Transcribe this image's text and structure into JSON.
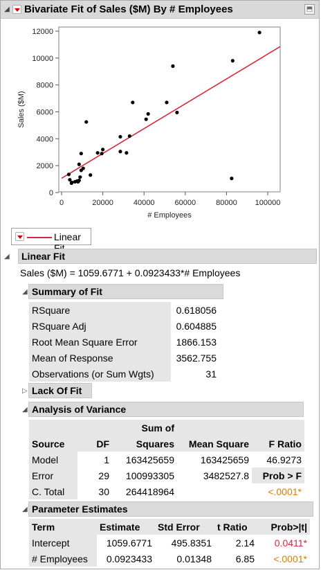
{
  "report": {
    "title": "Bivariate Fit of Sales ($M) By # Employees"
  },
  "chart_data": {
    "type": "scatter",
    "xlabel": "# Employees",
    "ylabel": "Sales ($M)",
    "xlim": [
      0,
      100000
    ],
    "ylim": [
      0,
      12000
    ],
    "x_ticks": [
      "0",
      "20000",
      "40000",
      "60000",
      "80000",
      "100000"
    ],
    "y_ticks": [
      "0",
      "2000",
      "4000",
      "6000",
      "8000",
      "10000",
      "12000"
    ],
    "points": [
      [
        96000,
        11900
      ],
      [
        83000,
        9800
      ],
      [
        54000,
        9400
      ],
      [
        51000,
        6700
      ],
      [
        56000,
        5950
      ],
      [
        42000,
        5850
      ],
      [
        41000,
        5450
      ],
      [
        34500,
        6700
      ],
      [
        33000,
        4200
      ],
      [
        28500,
        4150
      ],
      [
        12000,
        5250
      ],
      [
        9500,
        2900
      ],
      [
        17500,
        2950
      ],
      [
        20000,
        3200
      ],
      [
        19500,
        2900
      ],
      [
        28500,
        3050
      ],
      [
        31500,
        2950
      ],
      [
        8500,
        2100
      ],
      [
        10500,
        1800
      ],
      [
        9500,
        1650
      ],
      [
        14000,
        1300
      ],
      [
        9000,
        1150
      ],
      [
        8500,
        900
      ],
      [
        8000,
        800
      ],
      [
        3500,
        1350
      ],
      [
        4000,
        950
      ],
      [
        5000,
        750
      ],
      [
        4800,
        700
      ],
      [
        7500,
        850
      ],
      [
        6500,
        800
      ],
      [
        82500,
        1050
      ]
    ],
    "fit_line": {
      "intercept": 1059.6771,
      "slope": 0.0923433,
      "color": "#d6283b"
    },
    "point_color": "#000000",
    "grid": false
  },
  "legend": {
    "label": "Linear Fit",
    "color": "#d6283b"
  },
  "linear_fit": {
    "header": "Linear Fit",
    "equation": "Sales ($M) = 1059.6771 + 0.0923433*# Employees"
  },
  "summary_of_fit": {
    "header": "Summary of Fit",
    "rows": [
      {
        "label": "RSquare",
        "value": "0.618056"
      },
      {
        "label": "RSquare Adj",
        "value": "0.604885"
      },
      {
        "label": "Root Mean Square Error",
        "value": "1866.153"
      },
      {
        "label": "Mean of Response",
        "value": "3562.755"
      },
      {
        "label": "Observations (or Sum Wgts)",
        "value": "31"
      }
    ]
  },
  "lack_of_fit": {
    "header": "Lack Of Fit"
  },
  "anova": {
    "header": "Analysis of Variance",
    "columns": {
      "source": "Source",
      "df": "DF",
      "ss_top": "Sum of",
      "ss_bottom": "Squares",
      "ms": "Mean Square",
      "f": "F Ratio",
      "prob_label": "Prob > F"
    },
    "rows": [
      {
        "source": "Model",
        "df": "1",
        "ss": "163425659",
        "ms": "163425659",
        "f": "46.9273"
      },
      {
        "source": "Error",
        "df": "29",
        "ss": "100993305",
        "ms": "3482527.8",
        "f": ""
      },
      {
        "source": "C. Total",
        "df": "30",
        "ss": "264418964",
        "ms": "",
        "f": ""
      }
    ],
    "prob_value": "<.0001*"
  },
  "parameter_estimates": {
    "header": "Parameter Estimates",
    "columns": {
      "term": "Term",
      "estimate": "Estimate",
      "std_error": "Std Error",
      "t_ratio": "t Ratio",
      "prob": "Prob>|t|"
    },
    "rows": [
      {
        "term": "Intercept",
        "estimate": "1059.6771",
        "std_error": "495.8351",
        "t_ratio": "2.14",
        "prob": "0.0411*"
      },
      {
        "term": "# Employees",
        "estimate": "0.0923433",
        "std_error": "0.01348",
        "t_ratio": "6.85",
        "prob": "<.0001*"
      }
    ]
  },
  "icons": {
    "collapse": "disclosure-open-icon",
    "expand": "disclosure-closed-icon",
    "menu": "red-triangle-menu-icon",
    "pin": "pin-icon"
  }
}
